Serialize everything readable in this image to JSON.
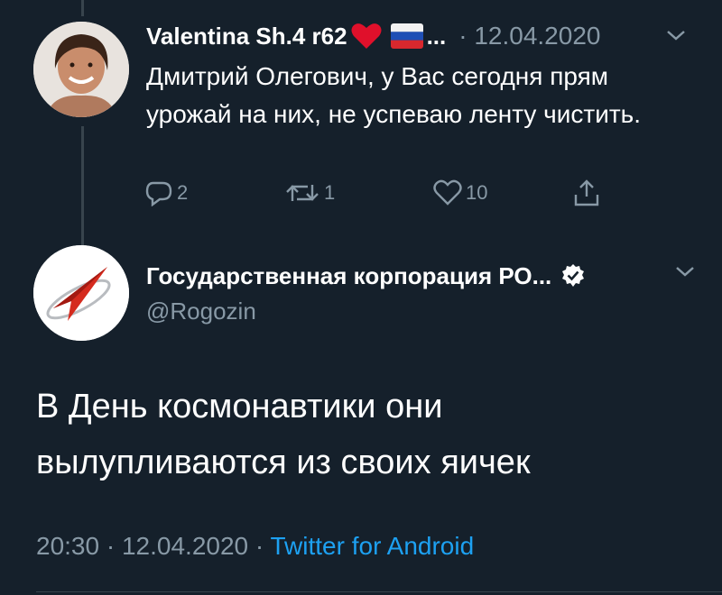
{
  "reply": {
    "display_name": "Valentina Sh.4 r62",
    "ellipsis": "...",
    "date": "· 12.04.2020",
    "body": "Дмитрий Олегович, у Вас сегодня прям урожай на них, не успеваю ленту чистить.",
    "actions": {
      "reply_count": "2",
      "retweet_count": "1",
      "like_count": "10"
    }
  },
  "tweet": {
    "display_name": "Государственная корпорация РО...",
    "handle": "@Rogozin",
    "text": "В День космонавтики они вылупливаются из своих яичек",
    "time": "20:30",
    "date": "12.04.2020",
    "source": "Twitter for Android"
  },
  "colors": {
    "background": "#15202b",
    "secondary_text": "#8899a6",
    "link": "#1da1f2",
    "heart_emoji": "#e0102b",
    "corp_logo_red": "#d52b1e"
  },
  "icons": [
    "thread-line",
    "heart-emoji-icon",
    "russian-flag-icon",
    "chevron-down-icon",
    "reply-icon",
    "retweet-icon",
    "like-icon",
    "share-icon",
    "verified-badge-icon",
    "roscosmos-logo"
  ]
}
